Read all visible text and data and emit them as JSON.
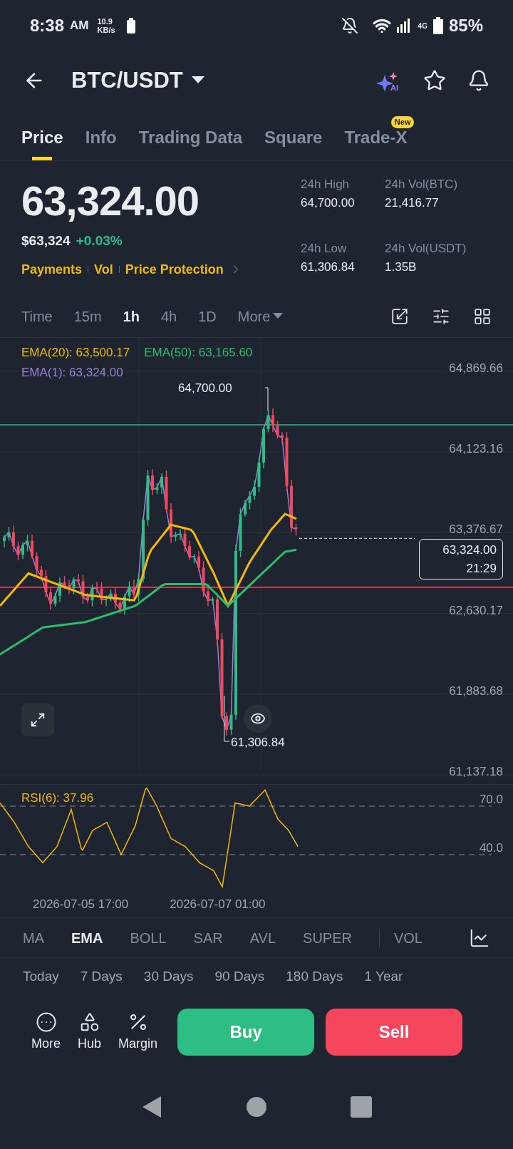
{
  "status_bar": {
    "time": "8:38",
    "meridiem": "AM",
    "speed": "10.9",
    "speed_unit": "KB/s",
    "network": "4G",
    "battery": "85%"
  },
  "header": {
    "title": "BTC/USDT",
    "ai_label": "AI"
  },
  "tabs": [
    {
      "label": "Price",
      "selected": true
    },
    {
      "label": "Info",
      "selected": false
    },
    {
      "label": "Trading Data",
      "selected": false
    },
    {
      "label": "Square",
      "selected": false
    },
    {
      "label": "Trade-X",
      "selected": false,
      "badge": "New"
    }
  ],
  "ticker": {
    "price": "63,324.00",
    "usd_price": "$63,324",
    "change": "+0.03%",
    "links": [
      "Payments",
      "Vol",
      "Price Protection"
    ],
    "stats": [
      {
        "label": "24h High",
        "value": "64,700.00"
      },
      {
        "label": "24h Vol(BTC)",
        "value": "21,416.77"
      },
      {
        "label": "24h Low",
        "value": "61,306.84"
      },
      {
        "label": "24h Vol(USDT)",
        "value": "1.35B"
      }
    ]
  },
  "timeframes": [
    {
      "label": "Time",
      "kind": "option",
      "selected": false
    },
    {
      "label": "15m",
      "kind": "option",
      "selected": false
    },
    {
      "label": "1h",
      "kind": "option",
      "selected": true
    },
    {
      "label": "4h",
      "kind": "option",
      "selected": false
    },
    {
      "label": "1D",
      "kind": "option",
      "selected": false
    },
    {
      "label": "More",
      "kind": "menu",
      "selected": false
    }
  ],
  "chart": {
    "legend": [
      {
        "label": "EMA(20): 63,500.17",
        "color": "#f0b90b"
      },
      {
        "label": "EMA(50): 63,165.60",
        "color": "#2ebd6b"
      },
      {
        "label": "EMA(1): 63,324.00",
        "color": "#9c7fd6"
      }
    ],
    "y_labels": [
      "64,869.66",
      "64,123.16",
      "63,376.67",
      "62,630.17",
      "61,883.68",
      "61,137.18"
    ],
    "high_label": "64,700.00",
    "low_label": "61,306.84",
    "current_price": "63,324.00",
    "countdown": "21:29"
  },
  "rsi": {
    "label": "RSI(6): 37.96",
    "levels": [
      "70.0",
      "40.0"
    ],
    "x_labels": [
      "2026-07-05 17:00",
      "2026-07-07 01:00"
    ]
  },
  "indicators": [
    {
      "label": "MA",
      "selected": false
    },
    {
      "label": "EMA",
      "selected": true
    },
    {
      "label": "BOLL",
      "selected": false
    },
    {
      "label": "SAR",
      "selected": false
    },
    {
      "label": "AVL",
      "selected": false
    },
    {
      "label": "SUPER",
      "selected": false
    },
    {
      "label": "VOL",
      "selected": false
    }
  ],
  "periods": [
    "Today",
    "7 Days",
    "30 Days",
    "90 Days",
    "180 Days",
    "1 Year"
  ],
  "actions": [
    {
      "label": "More",
      "kind": "more"
    },
    {
      "label": "Hub",
      "kind": "hub"
    },
    {
      "label": "Margin",
      "kind": "margin"
    }
  ],
  "buy": "Buy",
  "sell": "Sell"
}
